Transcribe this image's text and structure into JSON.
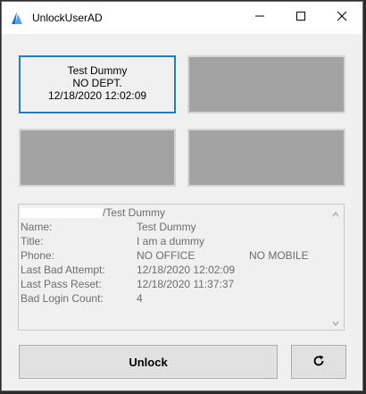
{
  "window": {
    "title": "UnlockUserAD",
    "icons": {
      "app": "app-logo-icon",
      "minimize": "minimize-icon",
      "maximize": "maximize-icon",
      "close": "close-icon"
    }
  },
  "cards": {
    "selected": {
      "name": "Test Dummy",
      "dept": "NO DEPT.",
      "timestamp": "12/18/2020 12:02:09"
    }
  },
  "details": {
    "heading_suffix": "/Test Dummy",
    "rows": [
      {
        "label": "Name:",
        "value": "Test Dummy",
        "extra": ""
      },
      {
        "label": "Title:",
        "value": "I am a dummy",
        "extra": ""
      },
      {
        "label": "Phone:",
        "value": "NO OFFICE",
        "extra": "NO MOBILE"
      },
      {
        "label": "Last Bad Attempt:",
        "value": "12/18/2020 12:02:09",
        "extra": ""
      },
      {
        "label": "Last Pass Reset:",
        "value": "12/18/2020 11:37:37",
        "extra": ""
      },
      {
        "label": "Bad Login Count:",
        "value": "4",
        "extra": ""
      }
    ]
  },
  "buttons": {
    "unlock_label": "Unlock",
    "refresh_icon": "refresh-icon"
  },
  "colors": {
    "accent": "#2a7ac2",
    "placeholder_card": "#a3a3a3",
    "window_bg": "#f0f0f0"
  }
}
